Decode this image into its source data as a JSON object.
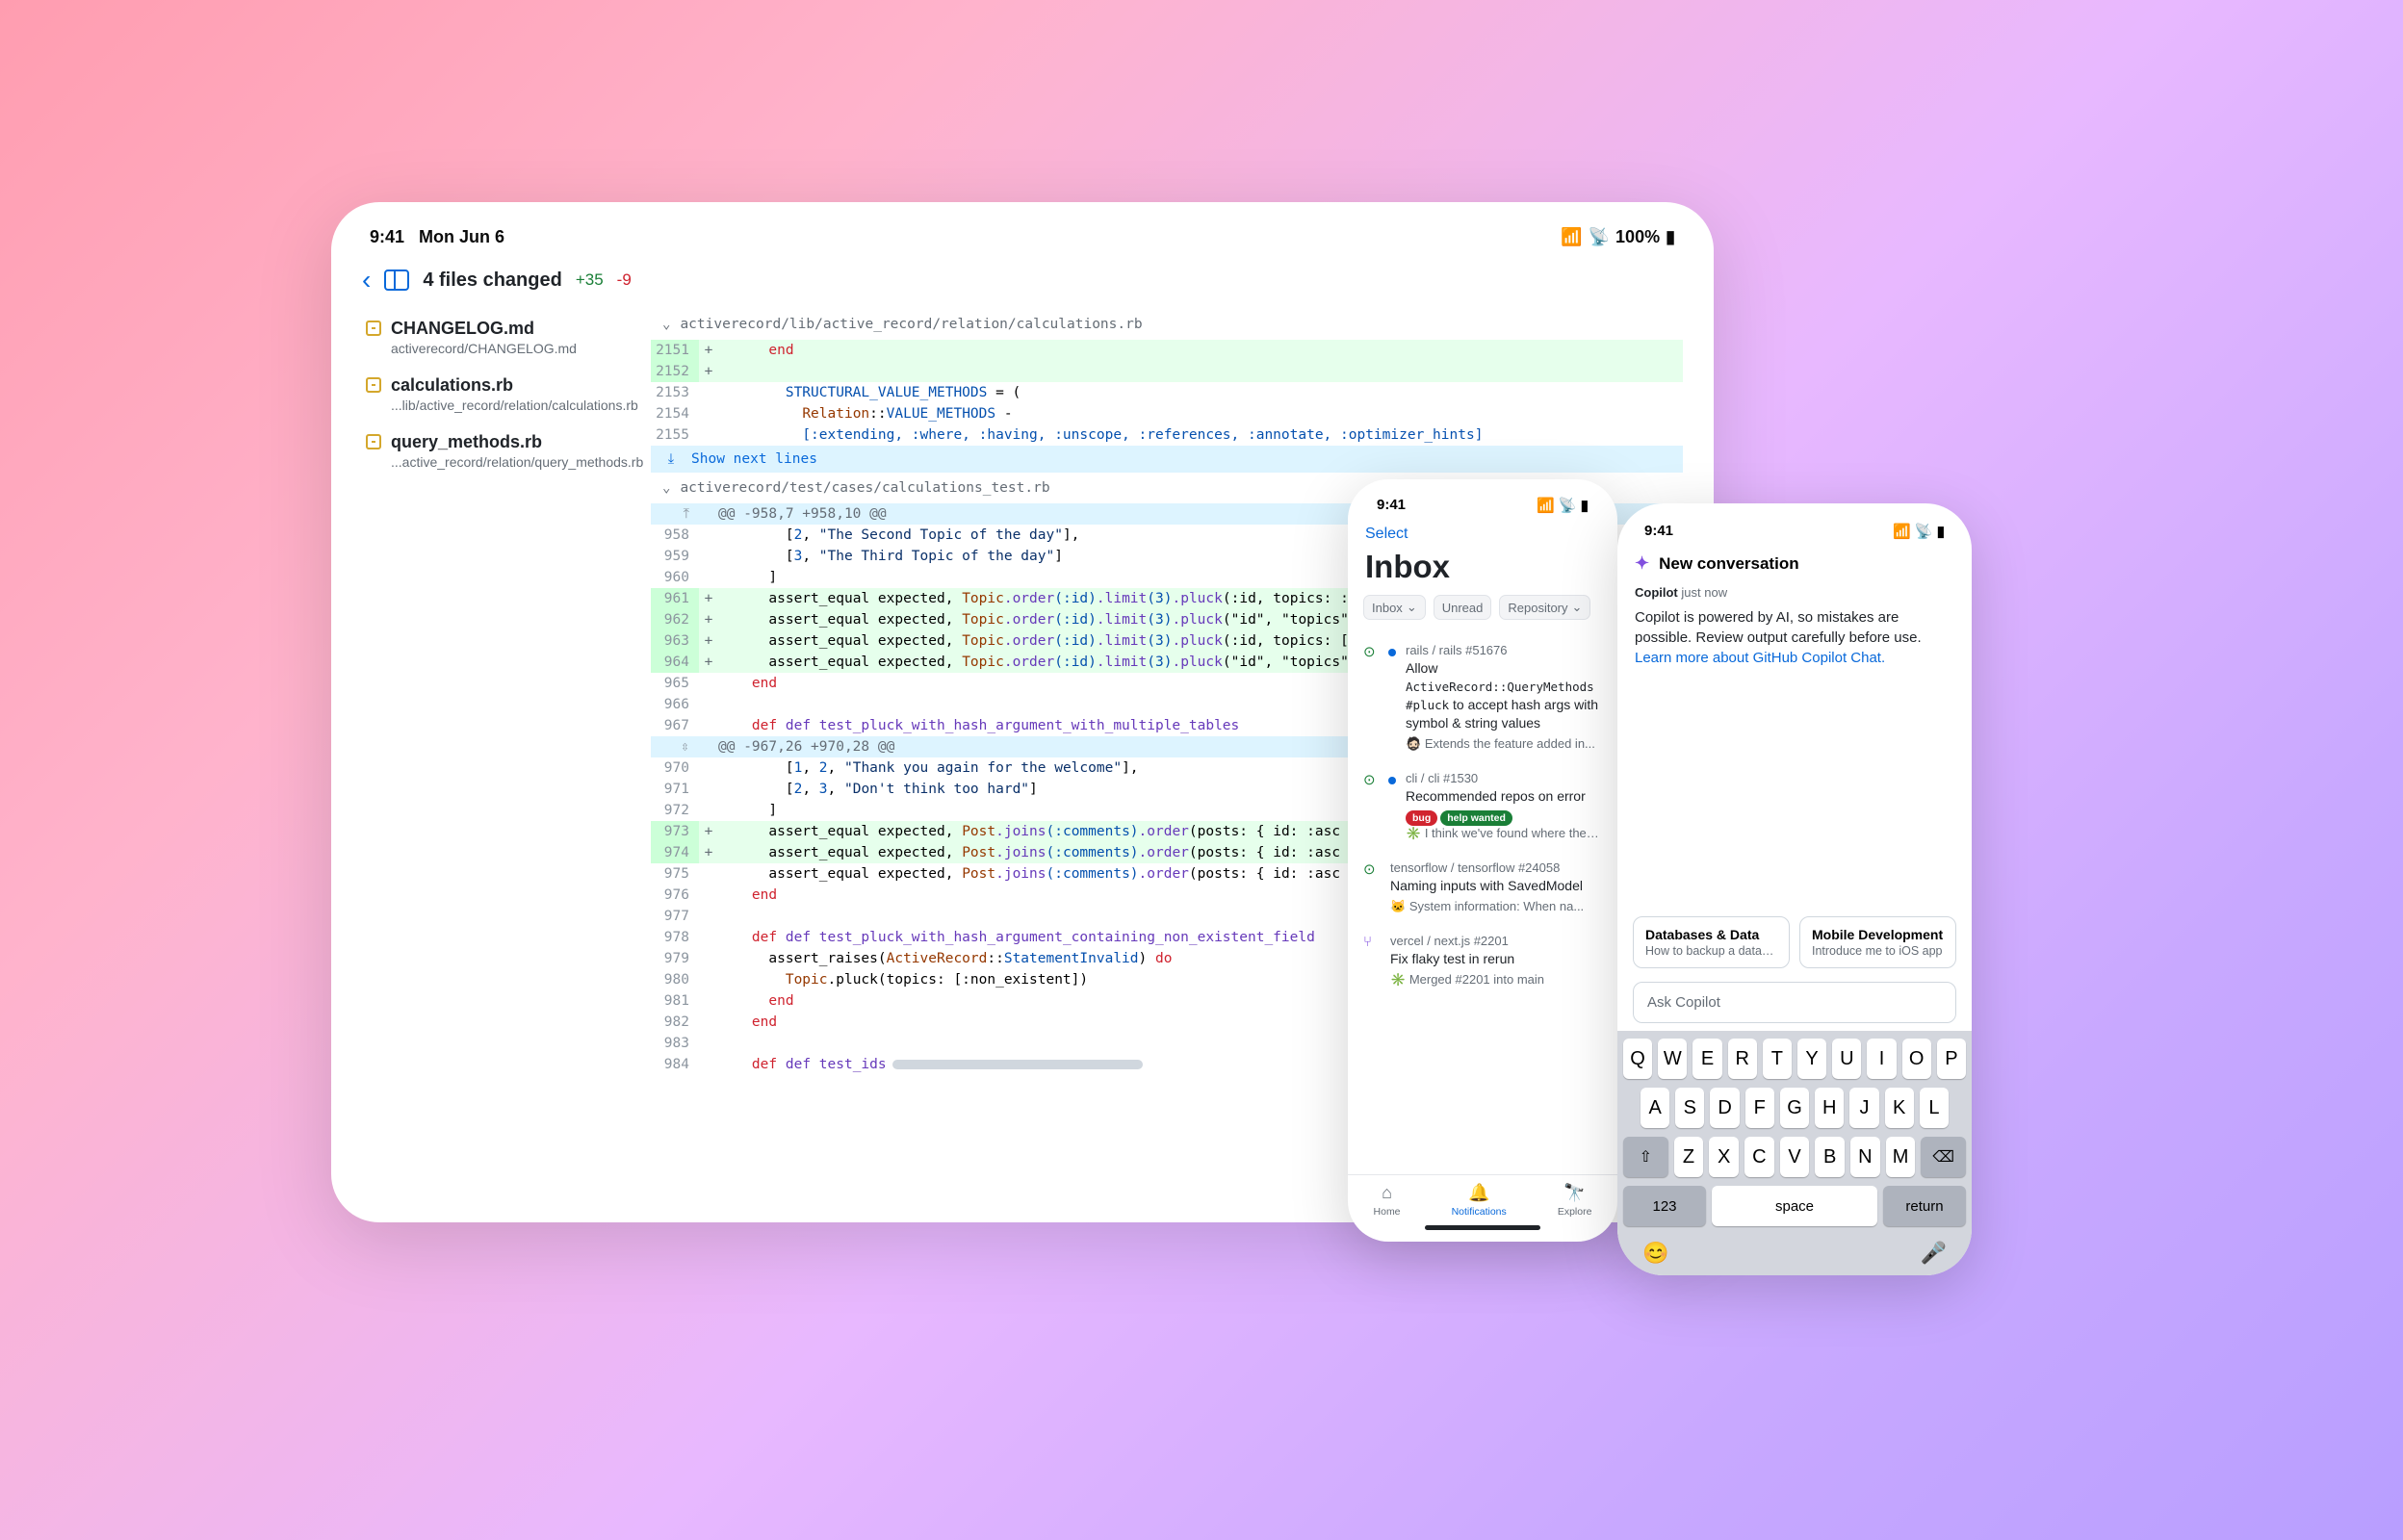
{
  "ipad": {
    "status": {
      "time": "9:41",
      "date": "Mon Jun 6",
      "battery": "100%"
    },
    "header": {
      "title": "4 files changed",
      "additions": "+35",
      "deletions": "-9"
    },
    "sidebar_files": [
      {
        "name": "CHANGELOG.md",
        "path": "activerecord/CHANGELOG.md"
      },
      {
        "name": "calculations.rb",
        "path": "...lib/active_record/relation/calculations.rb"
      },
      {
        "name": "query_methods.rb",
        "path": "...active_record/relation/query_methods.rb"
      }
    ],
    "diff_files": [
      {
        "path": "activerecord/lib/active_record/relation/calculations.rb"
      },
      {
        "path": "activerecord/test/cases/calculations_test.rb"
      }
    ],
    "show_next": "Show next lines",
    "lines1": {
      "l2151": "end",
      "l2153_a": "STRUCTURAL_VALUE_METHODS",
      "l2153_b": " = (",
      "l2154_a": "Relation",
      "l2154_b": "::",
      "l2154_c": "VALUE_METHODS",
      "l2154_d": " -",
      "l2155": "[:extending, :where, :having, :unscope, :references, :annotate, :optimizer_hints]"
    },
    "hunk1": "@@ -958,7 +958,10 @@",
    "lines2": {
      "l958_a": "[",
      "l958_b": "2",
      "l958_c": ", ",
      "l958_d": "\"The Second Topic of the day\"",
      "l958_e": "],",
      "l959_a": "[",
      "l959_b": "3",
      "l959_c": ", ",
      "l959_d": "\"The Third Topic of the day\"",
      "l959_e": "]",
      "l960": "]",
      "assert": "assert_equal expected, ",
      "topic": "Topic",
      "order": ".order",
      "id_sym": "(:id)",
      "limit": ".limit",
      "three": "(3)",
      "pluck": ".pluck",
      "p961": "(:id, topics: :ti",
      "p962": "(\"id\", \"topics\" =",
      "p963": "(:id, topics: [:t",
      "p964": "(\"id\", \"topics\" =",
      "end": "end",
      "def467": "def test_pluck_with_hash_argument_with_multiple_tables"
    },
    "hunk2": "@@ -967,26 +970,28 @@",
    "lines3": {
      "l970_a": "[",
      "l970_b": "1",
      "l970_c": ", ",
      "l970_d": "2",
      "l970_e": ", ",
      "l970_f": "\"Thank you again for the welcome\"",
      "l970_g": "],",
      "l971_a": "[",
      "l971_b": "2",
      "l971_c": ", ",
      "l971_d": "3",
      "l971_e": ", ",
      "l971_f": "\"Don't think too hard\"",
      "l971_g": "]",
      "l972": "]",
      "post": "Post",
      "joins": ".joins",
      "comments": "(:comments)",
      "order": ".order",
      "tail": "(posts: { id: :asc },",
      "end": "end",
      "def978": "def test_pluck_with_hash_argument_containing_non_existent_field",
      "raises_a": "assert_raises(",
      "raises_b": "ActiveRecord",
      "raises_c": "::",
      "raises_d": "StatementInvalid",
      "raises_e": ") ",
      "do": "do",
      "pluck_line_a": "Topic",
      "pluck_line_b": ".pluck(topics: [:non_existent])",
      "def984": "def test_ids"
    }
  },
  "inbox": {
    "status_time": "9:41",
    "select": "Select",
    "title": "Inbox",
    "filters": {
      "inbox": "Inbox",
      "unread": "Unread",
      "repository": "Repository"
    },
    "items": [
      {
        "icon": "open",
        "unread": true,
        "repo": "rails / rails #51676",
        "title_a": "Allow ",
        "title_mono": "ActiveRecord::QueryMethods #pluck",
        "title_b": " to accept hash args with symbol & string values",
        "sub_prefix": "🧔🏻",
        "sub": "Extends the feature added in..."
      },
      {
        "icon": "open",
        "unread": true,
        "repo": "cli / cli #1530",
        "title_a": "Recommended repos on error",
        "badges": [
          {
            "cls": "bug",
            "text": "bug"
          },
          {
            "cls": "help",
            "text": "help wanted"
          }
        ],
        "sub_prefix": "✳️",
        "sub": "I think we've found where the iss..."
      },
      {
        "icon": "open",
        "unread": false,
        "repo": "tensorflow / tensorflow #24058",
        "title_a": "Naming inputs with SavedModel",
        "sub_prefix": "🐱",
        "sub": "System information: When na..."
      },
      {
        "icon": "merged",
        "unread": false,
        "repo": "vercel / next.js #2201",
        "title_a": "Fix flaky test in rerun",
        "sub_prefix": "✳️",
        "sub": "Merged #2201 into main"
      }
    ],
    "tabs": {
      "home": "Home",
      "notifications": "Notifications",
      "explore": "Explore"
    }
  },
  "copilot": {
    "status_time": "9:41",
    "header": "New conversation",
    "meta_name": "Copilot",
    "meta_time": "just now",
    "msg_a": "Copilot is powered by AI, so mistakes are possible. Review output carefully before use. ",
    "msg_link": "Learn more about GitHub Copilot Chat.",
    "suggestions": [
      {
        "title": "Databases & Data",
        "sub": "How to backup a database?"
      },
      {
        "title": "Mobile Development",
        "sub": "Introduce me to iOS app"
      }
    ],
    "ask_placeholder": "Ask Copilot",
    "keyboard": {
      "r1": [
        "Q",
        "W",
        "E",
        "R",
        "T",
        "Y",
        "U",
        "I",
        "O",
        "P"
      ],
      "r2": [
        "A",
        "S",
        "D",
        "F",
        "G",
        "H",
        "J",
        "K",
        "L"
      ],
      "r3": [
        "Z",
        "X",
        "C",
        "V",
        "B",
        "N",
        "M"
      ],
      "shift": "⇧",
      "back": "⌫",
      "k123": "123",
      "space": "space",
      "return": "return",
      "emoji": "😊",
      "mic": "🎤"
    }
  }
}
